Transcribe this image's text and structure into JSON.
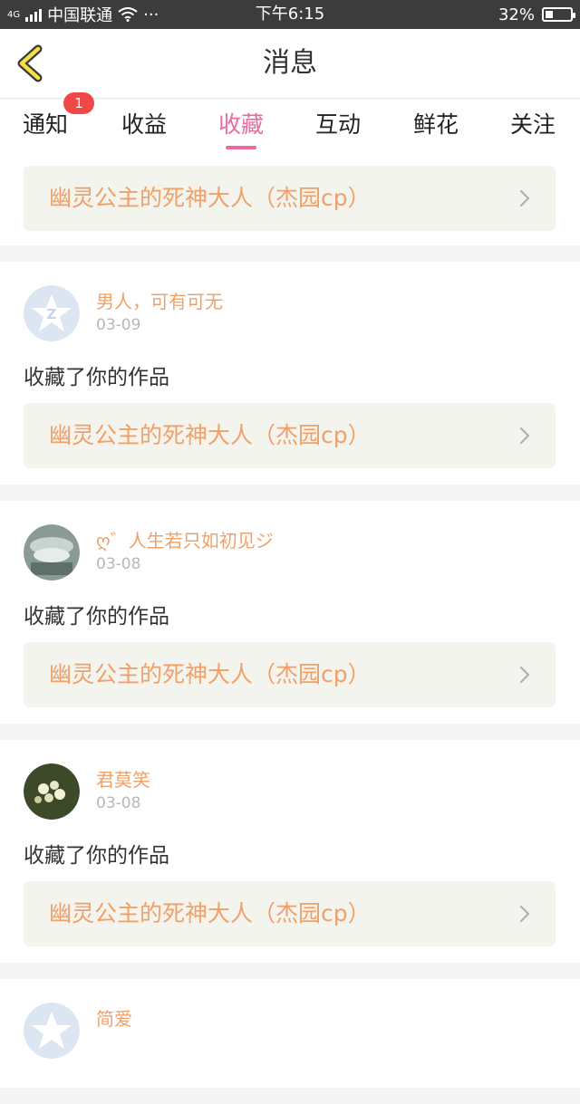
{
  "status_bar": {
    "network_tag": "4G",
    "carrier": "中国联通",
    "dots": "···",
    "time": "下午6:15",
    "battery": "32%",
    "battery_level": 0.32
  },
  "header": {
    "title": "消息"
  },
  "tabs": [
    {
      "label": "通知",
      "badge": "1"
    },
    {
      "label": "收益"
    },
    {
      "label": "收藏",
      "active": true
    },
    {
      "label": "互动"
    },
    {
      "label": "鲜花"
    },
    {
      "label": "关注"
    }
  ],
  "top_card": {
    "work_title": "幽灵公主的死神大人（杰园cp）"
  },
  "items": [
    {
      "user": "男人，可有可无",
      "date": "03-09",
      "action": "收藏了你的作品",
      "work_title": "幽灵公主的死神大人（杰园cp）"
    },
    {
      "user": "ღ゛人生若只如初见ジ",
      "date": "03-08",
      "action": "收藏了你的作品",
      "work_title": "幽灵公主的死神大人（杰园cp）"
    },
    {
      "user": "君莫笑",
      "date": "03-08",
      "action": "收藏了你的作品",
      "work_title": "幽灵公主的死神大人（杰园cp）"
    },
    {
      "user": "简爱"
    }
  ],
  "colors": {
    "accent": "#ea6aa0",
    "link": "#f0a068",
    "badge": "#f04747"
  }
}
